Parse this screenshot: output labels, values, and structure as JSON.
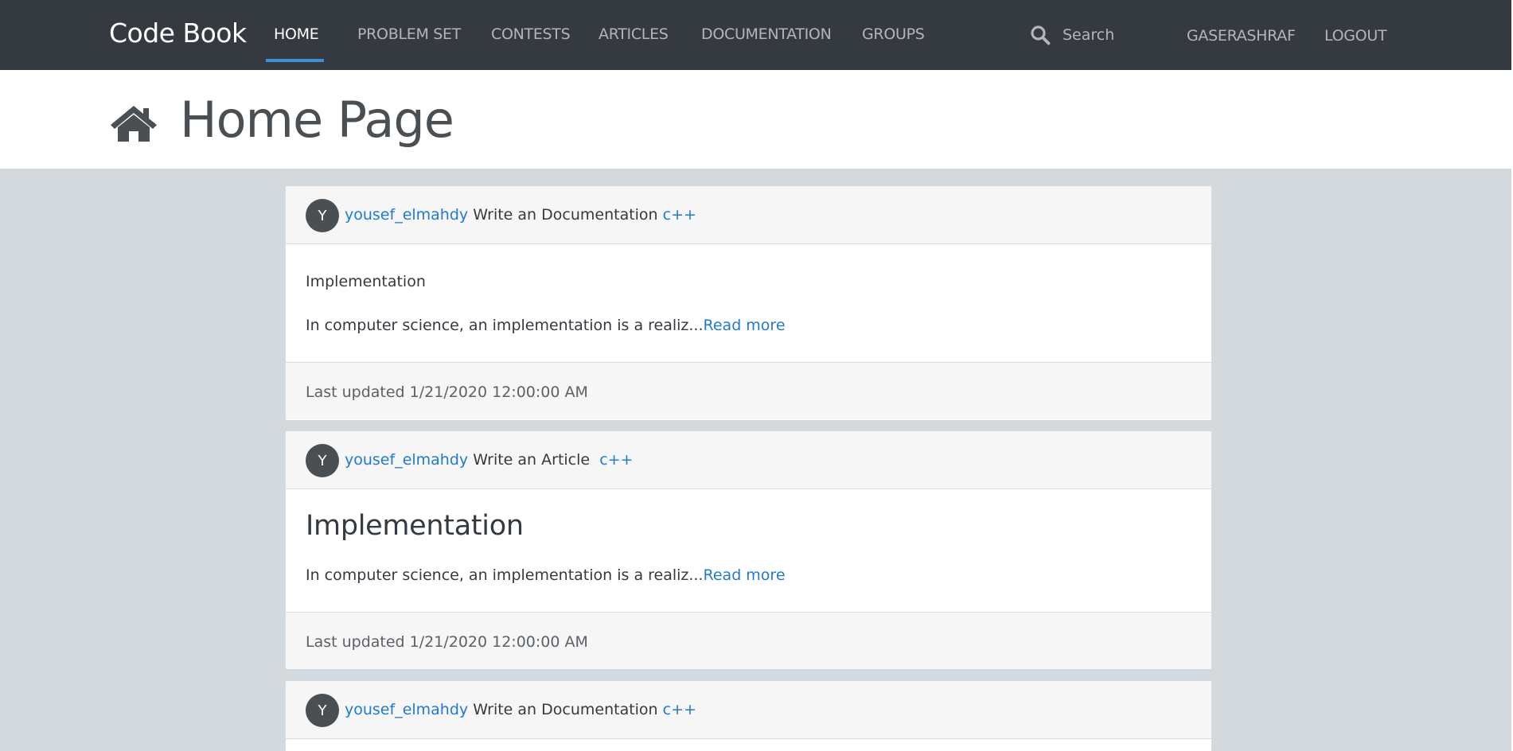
{
  "navbar": {
    "brand": "Code Book",
    "links": [
      {
        "label": "HOME"
      },
      {
        "label": "PROBLEM SET"
      },
      {
        "label": "CONTESTS"
      },
      {
        "label": "ARTICLES"
      },
      {
        "label": "DOCUMENTATION"
      },
      {
        "label": "GROUPS"
      }
    ],
    "active": "HOME",
    "search_placeholder": "Search",
    "search_icon": "search-icon",
    "user": "GASERASHRAF",
    "logout": "LOGOUT"
  },
  "page": {
    "title": "Home Page",
    "icon": "home-icon"
  },
  "colors": {
    "navbar_bg": "#343a40",
    "accent": "#3a8fd9",
    "link": "#1e7ad6",
    "page_bg": "#d4d9dd"
  },
  "feed": [
    {
      "avatar": "Y",
      "user": "yousef_elmahdy",
      "action": "Write an Documentation",
      "tag": "c++",
      "title": "Implementation",
      "excerpt": "In computer science, an implementation is a realiz...",
      "read_more": "Read more",
      "updated": "Last updated 1/21/2020 12:00:00 AM"
    },
    {
      "avatar": "Y",
      "user": "yousef_elmahdy",
      "action": "Write an Article",
      "tag": "c++",
      "title": "Implementation",
      "excerpt": "In computer science, an implementation is a realiz...",
      "read_more": "Read more",
      "updated": "Last updated 1/21/2020 12:00:00 AM"
    },
    {
      "avatar": "Y",
      "user": "yousef_elmahdy",
      "action": "Write an Documentation",
      "tag": "c++"
    }
  ]
}
